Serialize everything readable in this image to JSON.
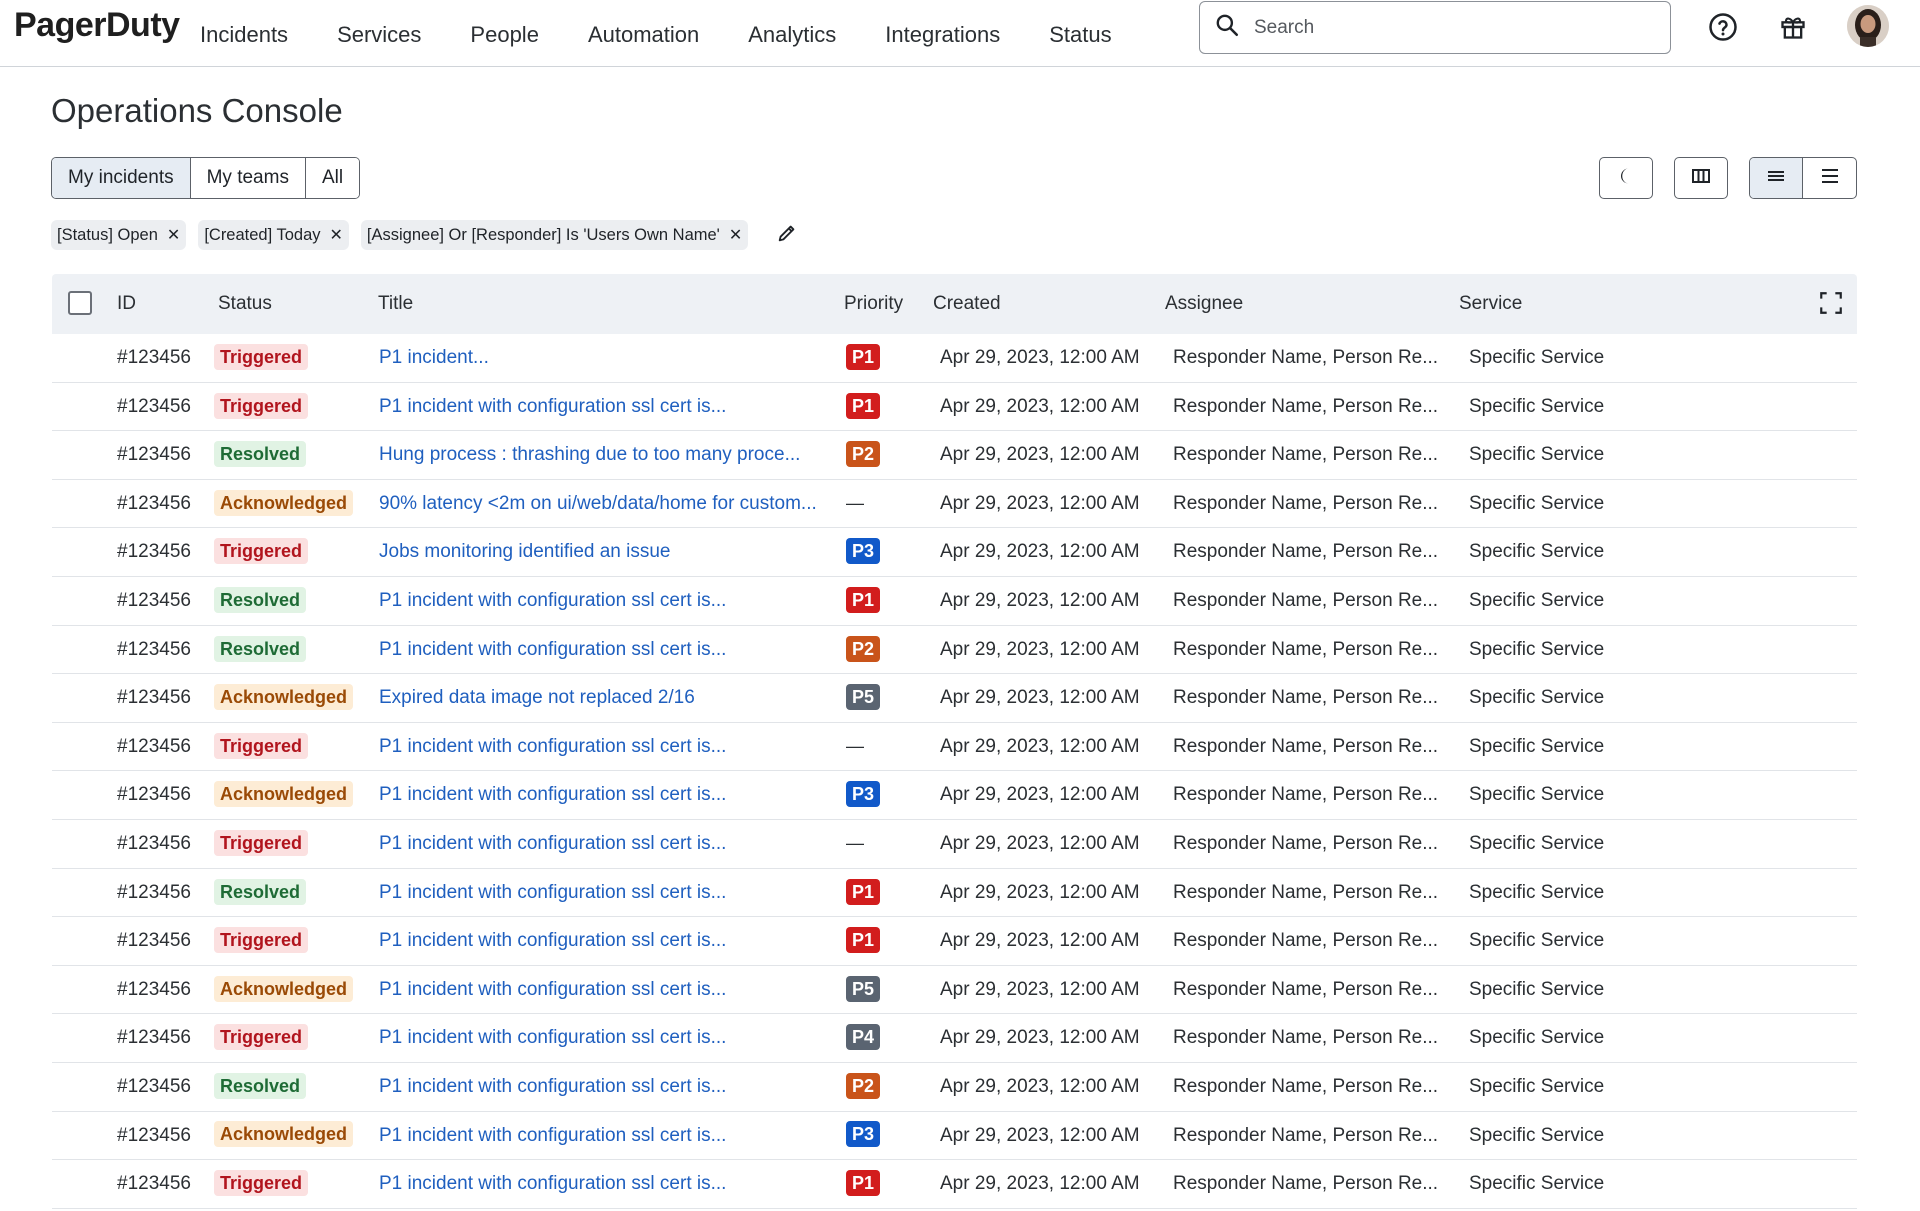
{
  "nav": {
    "logo": "PagerDuty",
    "links": [
      "Incidents",
      "Services",
      "People",
      "Automation",
      "Analytics",
      "Integrations",
      "Status"
    ],
    "search_placeholder": "Search"
  },
  "page": {
    "title": "Operations Console"
  },
  "segmented": {
    "items": [
      "My incidents",
      "My teams",
      "All"
    ],
    "active": "My incidents"
  },
  "filters": [
    "[Status] Open",
    "[Created] Today",
    "[Assignee] Or [Responder] Is 'Users Own Name'"
  ],
  "table": {
    "columns": [
      "ID",
      "Status",
      "Title",
      "Priority",
      "Created",
      "Assignee",
      "Service"
    ],
    "rows": [
      {
        "id": "#123456",
        "status": "Triggered",
        "title": "P1 incident...",
        "priority": "P1",
        "created": "Apr 29, 2023, 12:00 AM",
        "assignee": "Responder Name, Person Re...",
        "service": "Specific Service"
      },
      {
        "id": "#123456",
        "status": "Triggered",
        "title": "P1 incident with configuration ssl cert is...",
        "priority": "P1",
        "created": "Apr 29, 2023, 12:00 AM",
        "assignee": "Responder Name, Person Re...",
        "service": "Specific Service"
      },
      {
        "id": "#123456",
        "status": "Resolved",
        "title": "Hung process : thrashing due to too many proce...",
        "priority": "P2",
        "created": "Apr 29, 2023, 12:00 AM",
        "assignee": "Responder Name, Person Re...",
        "service": "Specific Service"
      },
      {
        "id": "#123456",
        "status": "Acknowledged",
        "title": "90% latency <2m on ui/web/data/home for custom...",
        "priority": "—",
        "created": "Apr 29, 2023, 12:00 AM",
        "assignee": "Responder Name, Person Re...",
        "service": "Specific Service"
      },
      {
        "id": "#123456",
        "status": "Triggered",
        "title": "Jobs monitoring identified an issue",
        "priority": "P3",
        "created": "Apr 29, 2023, 12:00 AM",
        "assignee": "Responder Name, Person Re...",
        "service": "Specific Service"
      },
      {
        "id": "#123456",
        "status": "Resolved",
        "title": "P1 incident with configuration ssl cert is...",
        "priority": "P1",
        "created": "Apr 29, 2023, 12:00 AM",
        "assignee": "Responder Name, Person Re...",
        "service": "Specific Service"
      },
      {
        "id": "#123456",
        "status": "Resolved",
        "title": "P1 incident with configuration ssl cert is...",
        "priority": "P2",
        "created": "Apr 29, 2023, 12:00 AM",
        "assignee": "Responder Name, Person Re...",
        "service": "Specific Service"
      },
      {
        "id": "#123456",
        "status": "Acknowledged",
        "title": "Expired data image not replaced 2/16",
        "priority": "P5",
        "created": "Apr 29, 2023, 12:00 AM",
        "assignee": "Responder Name, Person Re...",
        "service": "Specific Service"
      },
      {
        "id": "#123456",
        "status": "Triggered",
        "title": "P1 incident with configuration ssl cert is...",
        "priority": "—",
        "created": "Apr 29, 2023, 12:00 AM",
        "assignee": "Responder Name, Person Re...",
        "service": "Specific Service"
      },
      {
        "id": "#123456",
        "status": "Acknowledged",
        "title": "P1 incident with configuration ssl cert is...",
        "priority": "P3",
        "created": "Apr 29, 2023, 12:00 AM",
        "assignee": "Responder Name, Person Re...",
        "service": "Specific Service"
      },
      {
        "id": "#123456",
        "status": "Triggered",
        "title": "P1 incident with configuration ssl cert is...",
        "priority": "—",
        "created": "Apr 29, 2023, 12:00 AM",
        "assignee": "Responder Name, Person Re...",
        "service": "Specific Service"
      },
      {
        "id": "#123456",
        "status": "Resolved",
        "title": "P1 incident with configuration ssl cert is...",
        "priority": "P1",
        "created": "Apr 29, 2023, 12:00 AM",
        "assignee": "Responder Name, Person Re...",
        "service": "Specific Service"
      },
      {
        "id": "#123456",
        "status": "Triggered",
        "title": "P1 incident with configuration ssl cert is...",
        "priority": "P1",
        "created": "Apr 29, 2023, 12:00 AM",
        "assignee": "Responder Name, Person Re...",
        "service": "Specific Service"
      },
      {
        "id": "#123456",
        "status": "Acknowledged",
        "title": "P1 incident with configuration ssl cert is...",
        "priority": "P5",
        "created": "Apr 29, 2023, 12:00 AM",
        "assignee": "Responder Name, Person Re...",
        "service": "Specific Service"
      },
      {
        "id": "#123456",
        "status": "Triggered",
        "title": "P1 incident with configuration ssl cert is...",
        "priority": "P4",
        "created": "Apr 29, 2023, 12:00 AM",
        "assignee": "Responder Name, Person Re...",
        "service": "Specific Service"
      },
      {
        "id": "#123456",
        "status": "Resolved",
        "title": "P1 incident with configuration ssl cert is...",
        "priority": "P2",
        "created": "Apr 29, 2023, 12:00 AM",
        "assignee": "Responder Name, Person Re...",
        "service": "Specific Service"
      },
      {
        "id": "#123456",
        "status": "Acknowledged",
        "title": "P1 incident with configuration ssl cert is...",
        "priority": "P3",
        "created": "Apr 29, 2023, 12:00 AM",
        "assignee": "Responder Name, Person Re...",
        "service": "Specific Service"
      },
      {
        "id": "#123456",
        "status": "Triggered",
        "title": "P1 incident with configuration ssl cert is...",
        "priority": "P1",
        "created": "Apr 29, 2023, 12:00 AM",
        "assignee": "Responder Name, Person Re...",
        "service": "Specific Service"
      }
    ]
  },
  "icons": {
    "search": "search-icon",
    "help": "help-icon",
    "gift": "gift-icon",
    "dark_mode": "moon-icon",
    "columns": "columns-icon",
    "density_compact": "density-compact-icon",
    "density_comfortable": "density-comfortable-icon",
    "edit_filters": "pencil-icon",
    "expand": "fullscreen-icon",
    "chip_remove": "close-icon"
  },
  "colors": {
    "link": "#1f5fbf",
    "triggered_bg": "#fbe0e0",
    "triggered_text": "#b1141d",
    "resolved_bg": "#e1f3e4",
    "resolved_text": "#1e6b35",
    "acknowledged_bg": "#fdecd5",
    "acknowledged_text": "#9a4a06",
    "p1": "#d21d1d",
    "p2": "#c9541a",
    "p3": "#1159c9",
    "p4": "#5a6471",
    "p5": "#5a6471"
  }
}
